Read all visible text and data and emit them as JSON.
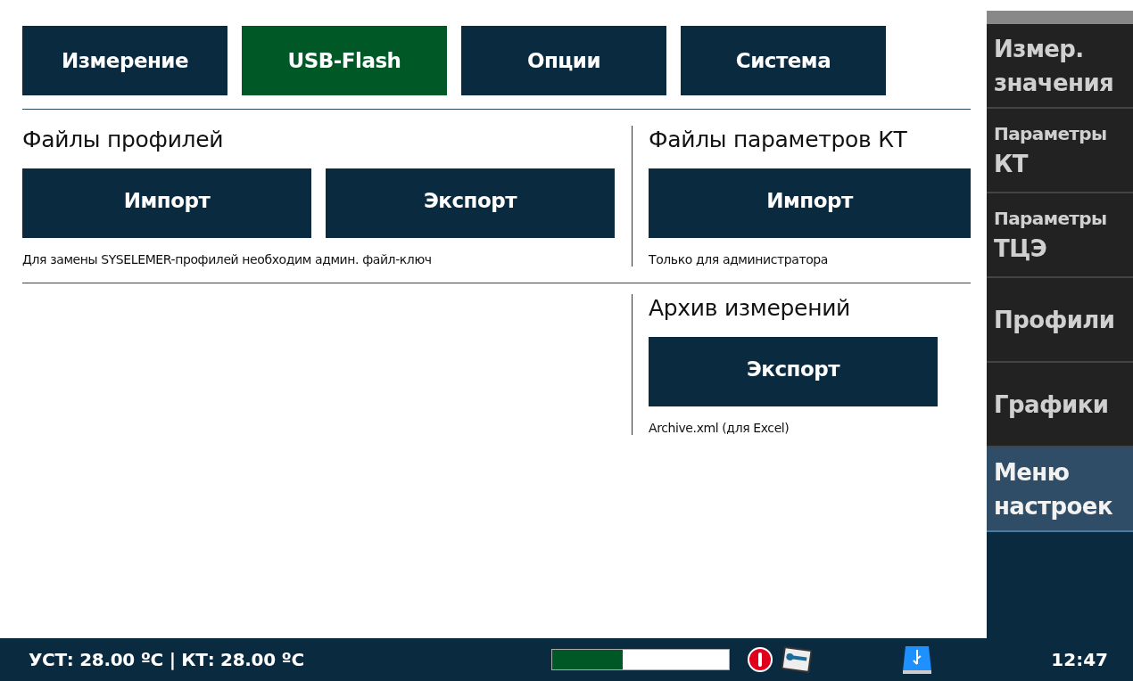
{
  "tabs": [
    {
      "label": "Измерение",
      "selected": false
    },
    {
      "label": "USB-Flash",
      "selected": true
    },
    {
      "label": "Опции",
      "selected": false
    },
    {
      "label": "Система",
      "selected": false
    }
  ],
  "profile_files": {
    "title": "Файлы профилей",
    "buttons": [
      "Импорт",
      "Экспорт"
    ],
    "note": "Для замены SYSELEMER-профилей необходим админ. файл-ключ"
  },
  "kt_parameter_files": {
    "title": "Файлы параметров КТ",
    "buttons": [
      "Импорт"
    ],
    "note": "Только для администратора"
  },
  "measurement_archive": {
    "title": "Архив измерений",
    "buttons": [
      "Экспорт"
    ],
    "note": "Archive.xml (для Excel)"
  },
  "sidebar": {
    "items": [
      {
        "lines": [
          "Измер.",
          "значения"
        ],
        "selected": false
      },
      {
        "lines": [
          "Параметры",
          "КТ"
        ],
        "selected": false
      },
      {
        "lines": [
          "Параметры",
          "ТЦЭ"
        ],
        "selected": false
      },
      {
        "lines": [
          "Профили"
        ],
        "selected": false
      },
      {
        "lines": [
          "Графики"
        ],
        "selected": false
      },
      {
        "lines": [
          "Меню",
          "настроек"
        ],
        "selected": true
      }
    ]
  },
  "status_bar": {
    "readout": "УСТ: 28.00 ºC | КТ: 28.00 ºC",
    "progress": {
      "level": 0.4
    },
    "time": "12:47"
  }
}
